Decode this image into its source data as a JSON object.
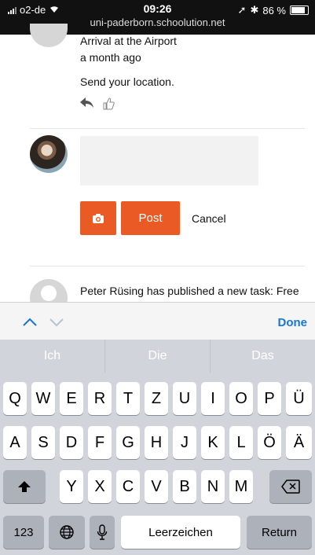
{
  "status_bar": {
    "carrier": "o2-de",
    "time": "09:26",
    "url": "uni-paderborn.schoolution.net",
    "battery_percent": "86 %"
  },
  "feed_item": {
    "title": "Arrival at the Airport",
    "time_ago": "a month ago",
    "message": "Send your location."
  },
  "comment_form": {
    "post_label": "Post",
    "cancel_label": "Cancel"
  },
  "next_item": {
    "text": "Peter Rüsing has published a new task: Free"
  },
  "keyboard": {
    "done_label": "Done",
    "suggestions": [
      "Ich",
      "Die",
      "Das"
    ],
    "row1": [
      "Q",
      "W",
      "E",
      "R",
      "T",
      "Z",
      "U",
      "I",
      "O",
      "P",
      "Ü"
    ],
    "row2": [
      "A",
      "S",
      "D",
      "F",
      "G",
      "H",
      "J",
      "K",
      "L",
      "Ö",
      "Ä"
    ],
    "row3": [
      "Y",
      "X",
      "C",
      "V",
      "B",
      "N",
      "M"
    ],
    "numbers_label": "123",
    "space_label": "Leerzeichen",
    "return_label": "Return"
  }
}
